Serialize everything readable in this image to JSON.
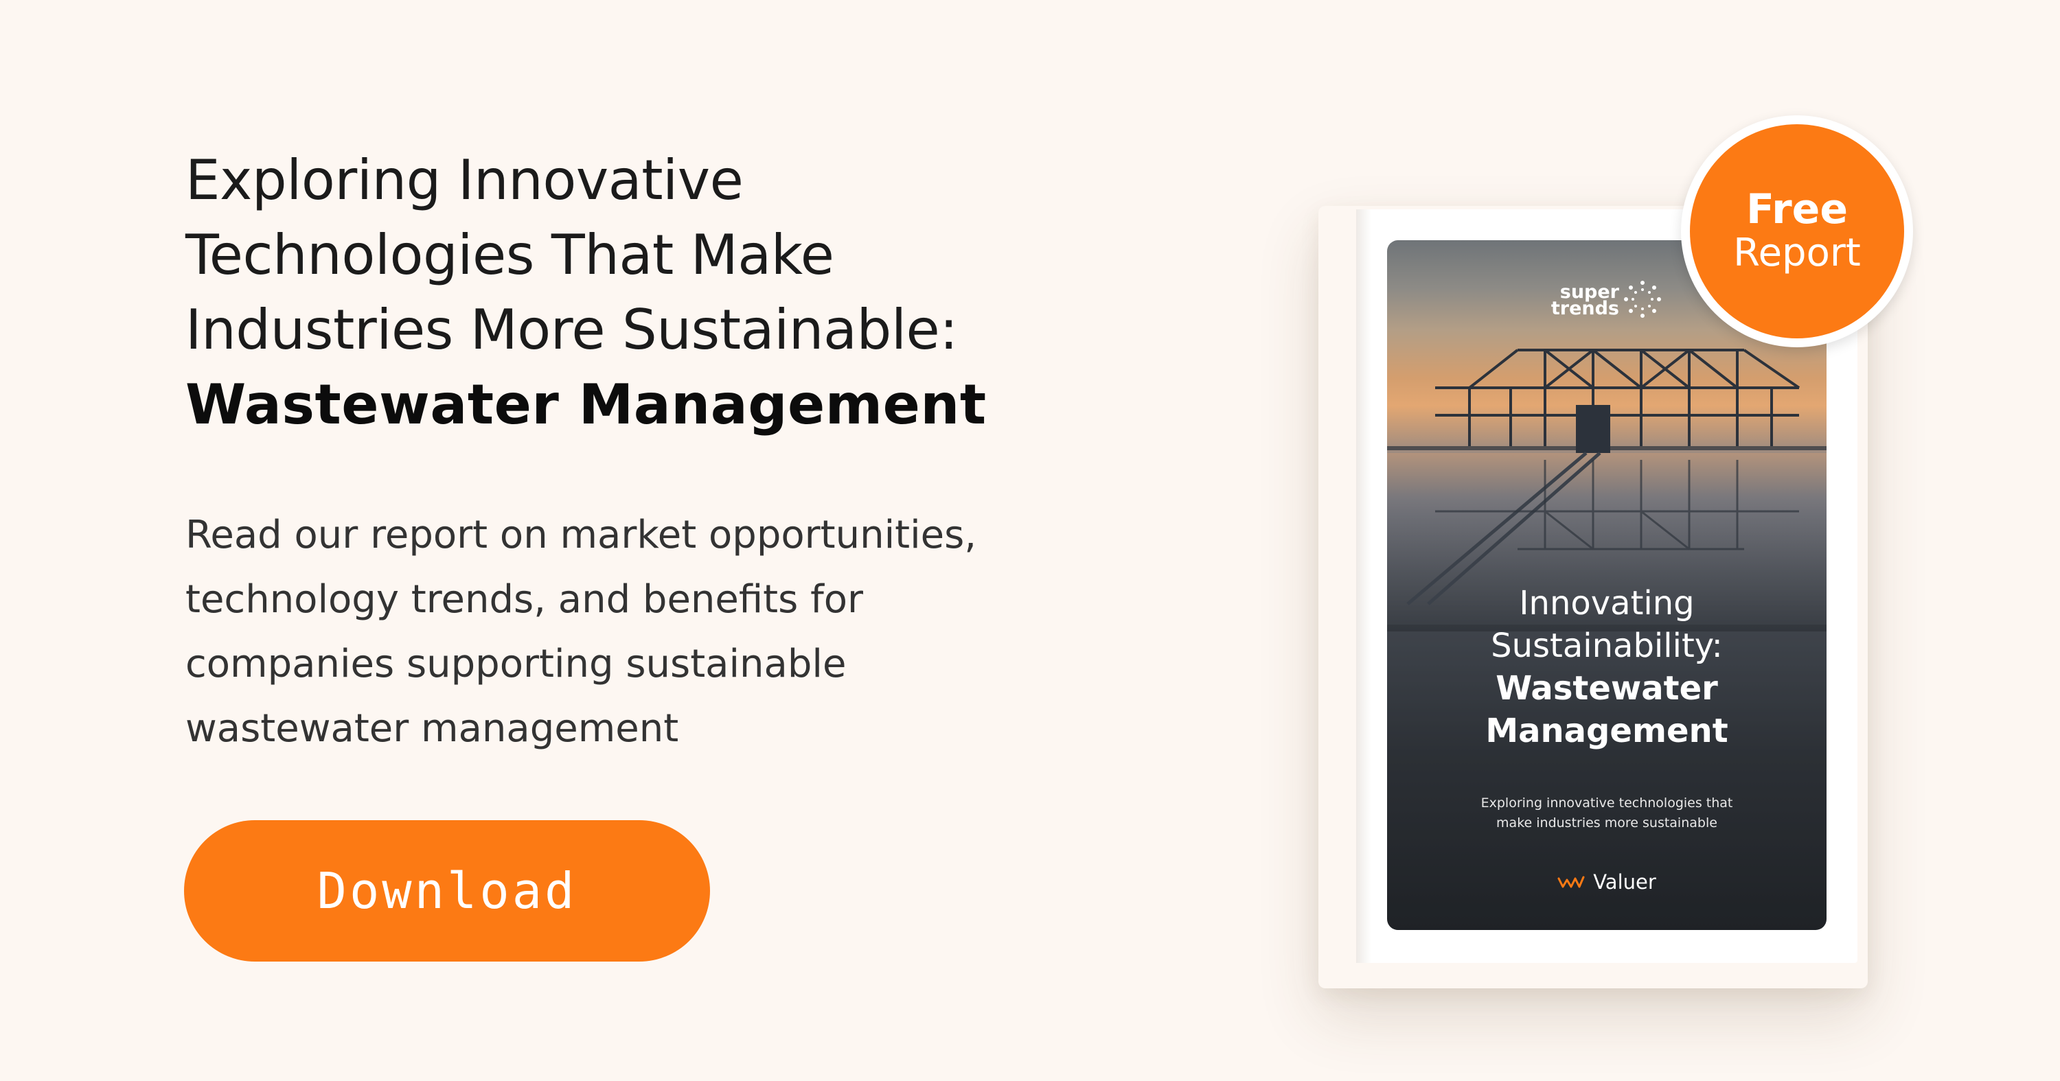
{
  "headline": {
    "line1": "Exploring Innovative",
    "line2": "Technologies That Make",
    "line3": "Industries More Sustainable:",
    "line4_bold": "Wastewater Management"
  },
  "description": {
    "line1": "Read our report on market opportunities,",
    "line2": "technology trends, and benefits for",
    "line3": "companies supporting sustainable",
    "line4": "wastewater management"
  },
  "cta": {
    "label": "Download",
    "color": "#fc7a14"
  },
  "badge": {
    "line1": "Free",
    "line2": "Report",
    "color": "#fc7a14"
  },
  "book_cover": {
    "logo_line1": "super",
    "logo_line2": "trends",
    "title_line1": "Innovating",
    "title_line2": "Sustainability:",
    "title_line3": "Wastewater",
    "title_line4": "Management",
    "subtitle_line1": "Exploring innovative technologies that",
    "subtitle_line2": "make industries more sustainable",
    "brand": "Valuer",
    "brand_icon": "valuer-wave-icon",
    "logo_icon": "starburst-icon"
  },
  "colors": {
    "background": "#fdf7f2",
    "text": "#1b1b1b",
    "accent": "#fc7a14"
  }
}
